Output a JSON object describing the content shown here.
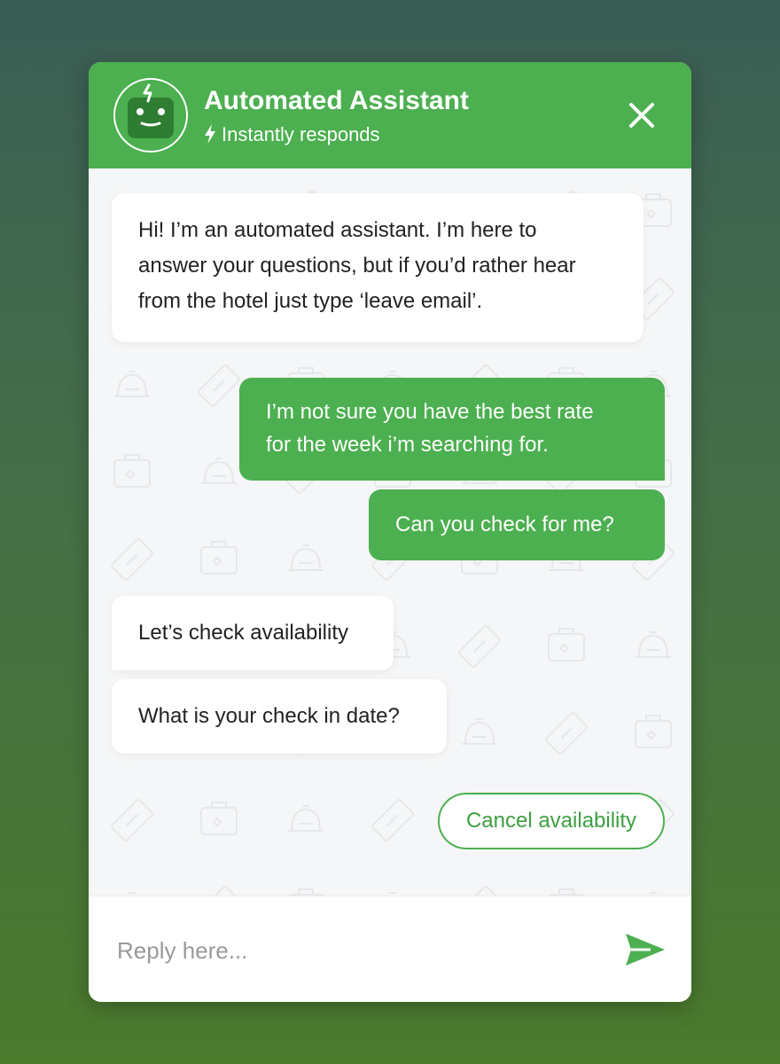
{
  "header": {
    "title": "Automated Assistant",
    "subtitle": "Instantly responds",
    "avatar_icon": "robot-icon",
    "status_icon": "lightning-bolt-icon",
    "close_icon": "close-icon"
  },
  "messages": [
    {
      "sender": "bot",
      "text": "Hi! I’m an automated assistant. I’m here to\nanswer your questions, but if you’d rather hear\nfrom the hotel just type ‘leave email’."
    },
    {
      "sender": "user",
      "text": "I’m not sure you have the best rate\nfor the week i’m searching for."
    },
    {
      "sender": "user",
      "text": "Can you check for me?"
    },
    {
      "sender": "bot",
      "text": "Let’s check availability"
    },
    {
      "sender": "bot",
      "text": "What is your check in date?"
    }
  ],
  "quick_reply": {
    "label": "Cancel availability"
  },
  "composer": {
    "placeholder": "Reply here...",
    "value": "",
    "send_icon": "send-icon"
  },
  "colors": {
    "brand_green": "#4caf50",
    "background_top": "#3a5d55",
    "background_bottom": "#4a7a2c",
    "chat_background": "#f5f6f7"
  }
}
